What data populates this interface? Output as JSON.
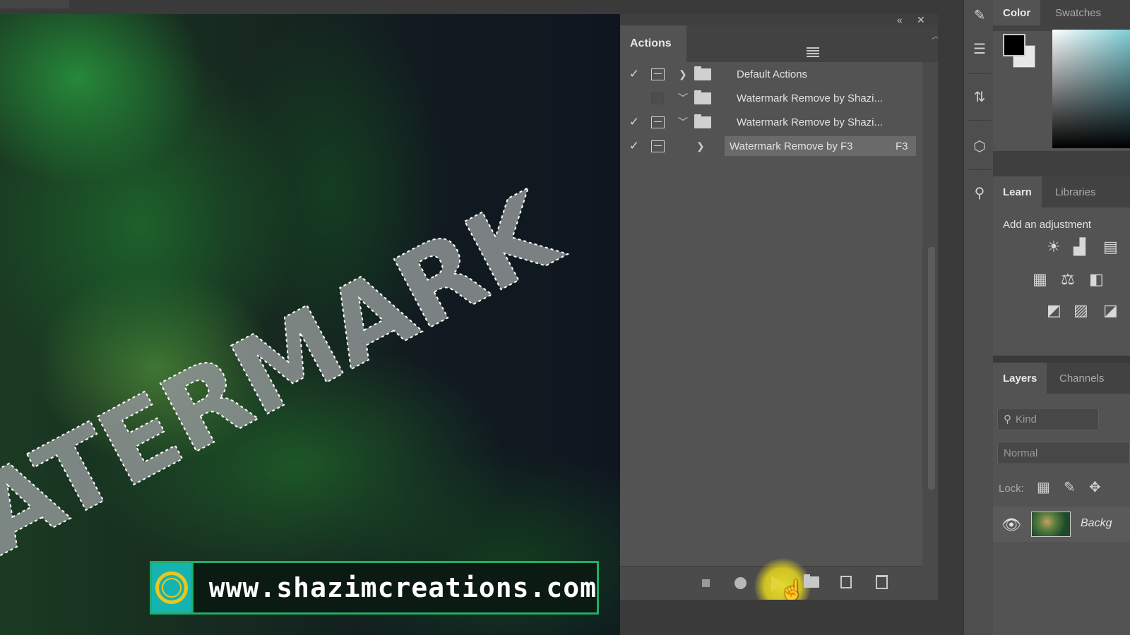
{
  "canvas": {
    "watermark_text": "WATERMARK",
    "url_text": "www.shazimcreations.com"
  },
  "actions_panel": {
    "tab_label": "Actions",
    "rows": [
      {
        "checked": true,
        "dialog": true,
        "expanded": false,
        "type": "set",
        "label": "Default Actions"
      },
      {
        "checked": false,
        "dialog": false,
        "expanded": true,
        "type": "set",
        "label": "Watermark Remove by Shazi..."
      },
      {
        "checked": true,
        "dialog": true,
        "expanded": true,
        "type": "set",
        "label": "Watermark Remove by Shazi..."
      },
      {
        "checked": true,
        "dialog": true,
        "expanded": false,
        "type": "action",
        "label": "Watermark Remove by F3",
        "shortcut": "F3",
        "selected": true
      }
    ]
  },
  "color_panel": {
    "tabs": [
      "Color",
      "Swatches"
    ],
    "foreground": "#000000",
    "background": "#e8e8e8"
  },
  "adjustments_panel": {
    "tabs": [
      "Learn",
      "Libraries"
    ],
    "title": "Add an adjustment"
  },
  "layers_panel": {
    "tabs": [
      "Layers",
      "Channels"
    ],
    "filter_placeholder": "Kind",
    "blend_mode": "Normal",
    "lock_label": "Lock:",
    "layers": [
      {
        "name": "Backg",
        "visible": true
      }
    ]
  },
  "colors": {
    "accent_yellow": "#e4d43a",
    "banner_green": "#1fae67",
    "logo_teal": "#17b3b0"
  }
}
